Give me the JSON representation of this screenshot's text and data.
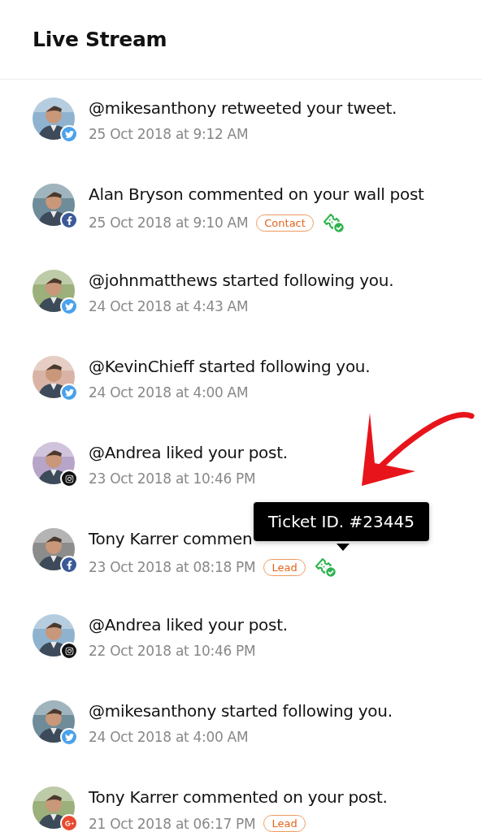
{
  "header": {
    "title": "Live Stream"
  },
  "items": [
    {
      "kind": "twitter",
      "message": "@mikesanthony retweeted your tweet.",
      "time": "25 Oct 2018 at 9:12 AM",
      "ticket": false
    },
    {
      "kind": "facebook",
      "message": "Alan Bryson commented on your wall post",
      "time": "25 Oct 2018 at 9:10 AM",
      "tag": "Contact",
      "ticket": true
    },
    {
      "kind": "twitter",
      "message": "@johnmatthews started following you.",
      "time": "24 Oct 2018 at 4:43 AM",
      "ticket": false
    },
    {
      "kind": "twitter",
      "message": "@KevinChieff started following you.",
      "time": "24 Oct 2018 at 4:00 AM",
      "ticket": false
    },
    {
      "kind": "instagram",
      "message": "@Andrea liked your post.",
      "time": "23 Oct 2018 at 10:46 PM",
      "ticket": false
    },
    {
      "kind": "facebook",
      "message": "Tony Karrer commen",
      "time": "23 Oct 2018 at 08:18 PM",
      "tag": "Lead",
      "ticket": true,
      "tooltip": "Ticket ID. #23445"
    },
    {
      "kind": "instagram",
      "message": "@Andrea liked your post.",
      "time": "22 Oct 2018 at 10:46 PM",
      "ticket": false
    },
    {
      "kind": "twitter",
      "message": "@mikesanthony started following you.",
      "time": "24 Oct 2018 at 4:00 AM",
      "ticket": false
    },
    {
      "kind": "google",
      "message": "Tony Karrer commented on your post.",
      "time": "21 Oct 2018 at 06:17 PM",
      "tag": "Lead",
      "ticket": false
    }
  ]
}
